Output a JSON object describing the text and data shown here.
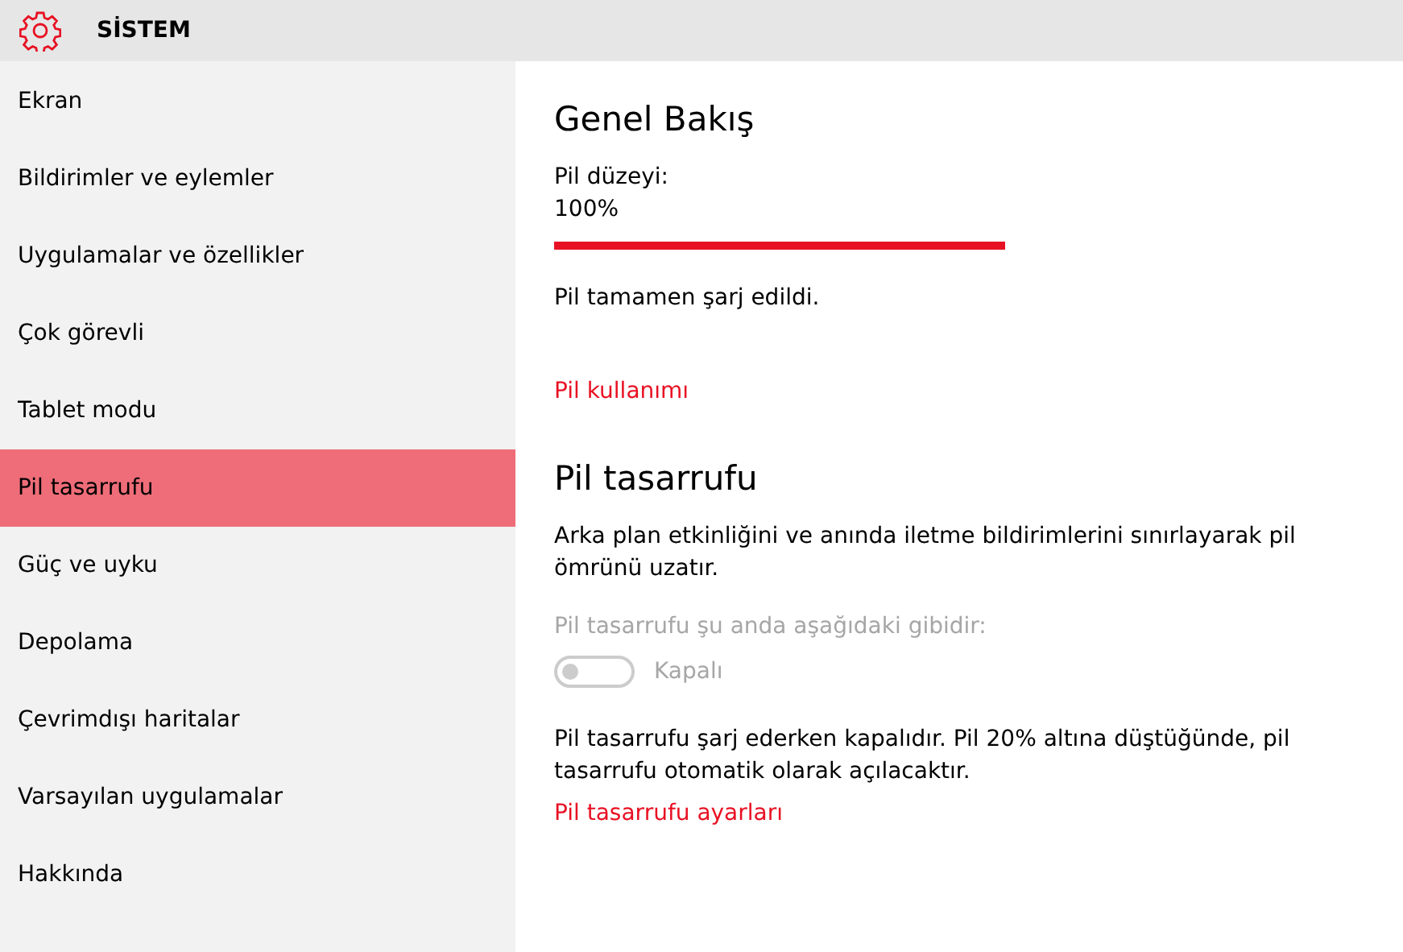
{
  "header": {
    "title": "SİSTEM"
  },
  "sidebar": {
    "items": [
      {
        "label": "Ekran",
        "selected": false
      },
      {
        "label": "Bildirimler ve eylemler",
        "selected": false
      },
      {
        "label": "Uygulamalar ve özellikler",
        "selected": false
      },
      {
        "label": "Çok görevli",
        "selected": false
      },
      {
        "label": "Tablet modu",
        "selected": false
      },
      {
        "label": "Pil tasarrufu",
        "selected": true
      },
      {
        "label": "Güç ve uyku",
        "selected": false
      },
      {
        "label": "Depolama",
        "selected": false
      },
      {
        "label": "Çevrimdışı haritalar",
        "selected": false
      },
      {
        "label": "Varsayılan uygulamalar",
        "selected": false
      },
      {
        "label": "Hakkında",
        "selected": false
      }
    ]
  },
  "overview": {
    "heading": "Genel Bakış",
    "battery_label": "Pil düzeyi:",
    "battery_value": "100%",
    "battery": {
      "level": 1
    },
    "status": "Pil tamamen şarj edildi.",
    "link": "Pil kullanımı"
  },
  "saver": {
    "heading": "Pil tasarrufu",
    "description": "Arka plan etkinliğini ve anında iletme bildirimlerini sınırlayarak pil ömrünü uzatır.",
    "toggle_caption": "Pil tasarrufu şu anda aşağıdaki gibidir:",
    "toggle": {
      "on": false,
      "disabled": true,
      "label": "Kapalı"
    },
    "note": "Pil tasarrufu şarj ederken kapalıdır. Pil 20% altına düştüğünde, pil tasarrufu otomatik olarak açılacaktır.",
    "link": "Pil tasarrufu ayarları"
  }
}
